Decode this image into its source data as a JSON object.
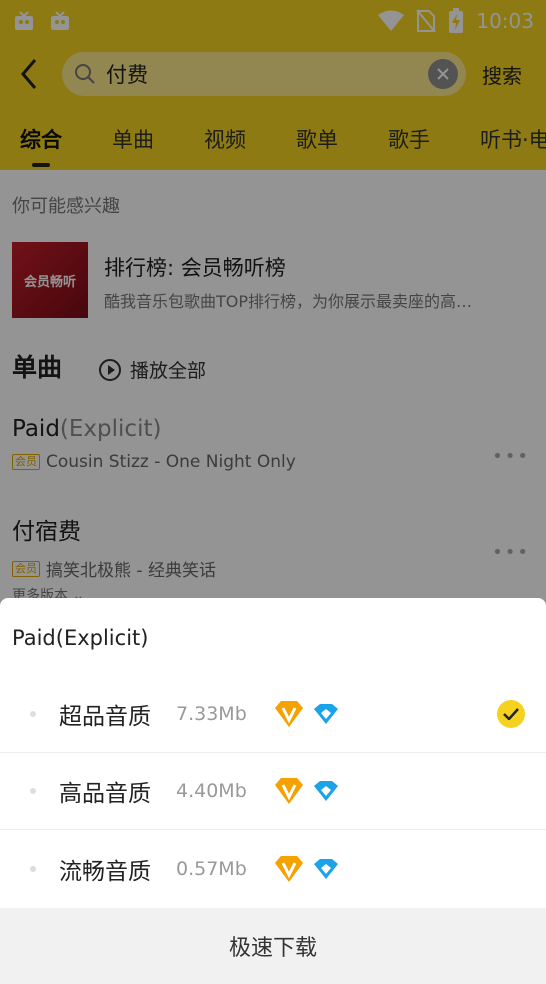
{
  "status": {
    "time": "10:03"
  },
  "header": {
    "query": "付费",
    "search_button": "搜索"
  },
  "tabs": [
    "综合",
    "单曲",
    "视频",
    "歌单",
    "歌手",
    "听书·电"
  ],
  "content": {
    "section_label": "你可能感兴趣",
    "recommend": {
      "cover_text": "会员畅听",
      "title": "排行榜: 会员畅听榜",
      "desc": "酷我音乐包歌曲TOP排行榜，为你展示最卖座的高…"
    },
    "songs_header": "单曲",
    "play_all": "播放全部",
    "songs": [
      {
        "title": "Paid",
        "title_sub": "(Explicit)",
        "badge": "会员",
        "artist_album": "Cousin Stizz - One Night Only",
        "more": ""
      },
      {
        "title": "付宿费",
        "title_sub": "",
        "badge": "会员",
        "artist_album": "搞笑北极熊 - 经典笑话",
        "more": "更多版本"
      }
    ]
  },
  "sheet": {
    "title": "Paid(Explicit)",
    "options": [
      {
        "name": "超品音质",
        "size": "7.33Mb",
        "selected": true
      },
      {
        "name": "高品音质",
        "size": "4.40Mb",
        "selected": false
      },
      {
        "name": "流畅音质",
        "size": "0.57Mb",
        "selected": false
      }
    ],
    "download_button": "极速下载"
  },
  "colors": {
    "accent": "#f5d21f",
    "vip_orange": "#f5a100",
    "vip_blue": "#1aa3e8"
  }
}
